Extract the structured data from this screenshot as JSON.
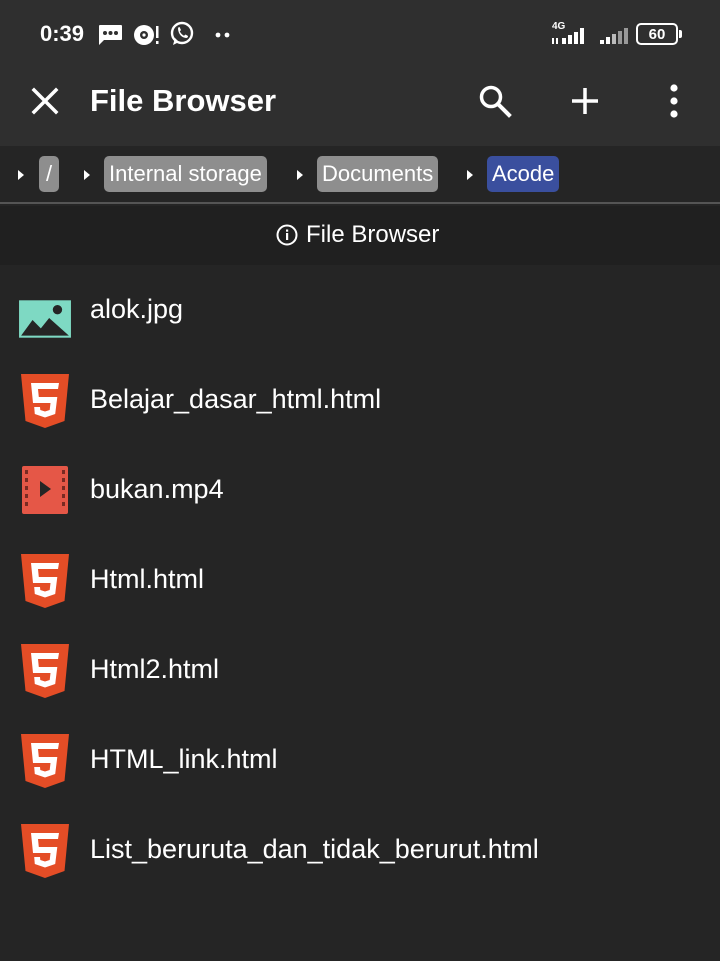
{
  "status_bar": {
    "time": "0:39",
    "network_type": "4G",
    "battery": "60",
    "icons": [
      "message-icon",
      "cast-notification-icon",
      "whatsapp-icon",
      "more-dots-icon",
      "signal-4g-icon",
      "signal-icon",
      "battery-icon"
    ]
  },
  "header": {
    "title": "File Browser",
    "close_icon": "close-icon",
    "search_icon": "search-icon",
    "add_icon": "plus-icon",
    "menu_icon": "more-vert-icon"
  },
  "breadcrumb": {
    "items": [
      {
        "label": "/"
      },
      {
        "label": "Internal storage"
      },
      {
        "label": "Documents"
      },
      {
        "label": "Acode"
      }
    ],
    "active_color": "#3a4f9e"
  },
  "info": {
    "label": "File Browser",
    "icon": "info-icon"
  },
  "files": [
    {
      "name": "alok.jpg",
      "type": "image"
    },
    {
      "name": "Belajar_dasar_html.html",
      "type": "html"
    },
    {
      "name": "bukan.mp4",
      "type": "video"
    },
    {
      "name": "Html.html",
      "type": "html"
    },
    {
      "name": "Html2.html",
      "type": "html"
    },
    {
      "name": "HTML_link.html",
      "type": "html"
    },
    {
      "name": "List_beruruta_dan_tidak_berurut.html",
      "type": "html"
    }
  ],
  "colors": {
    "html_icon": "#e44d26",
    "image_icon": "#7ed9c3",
    "video_icon": "#e55747"
  }
}
